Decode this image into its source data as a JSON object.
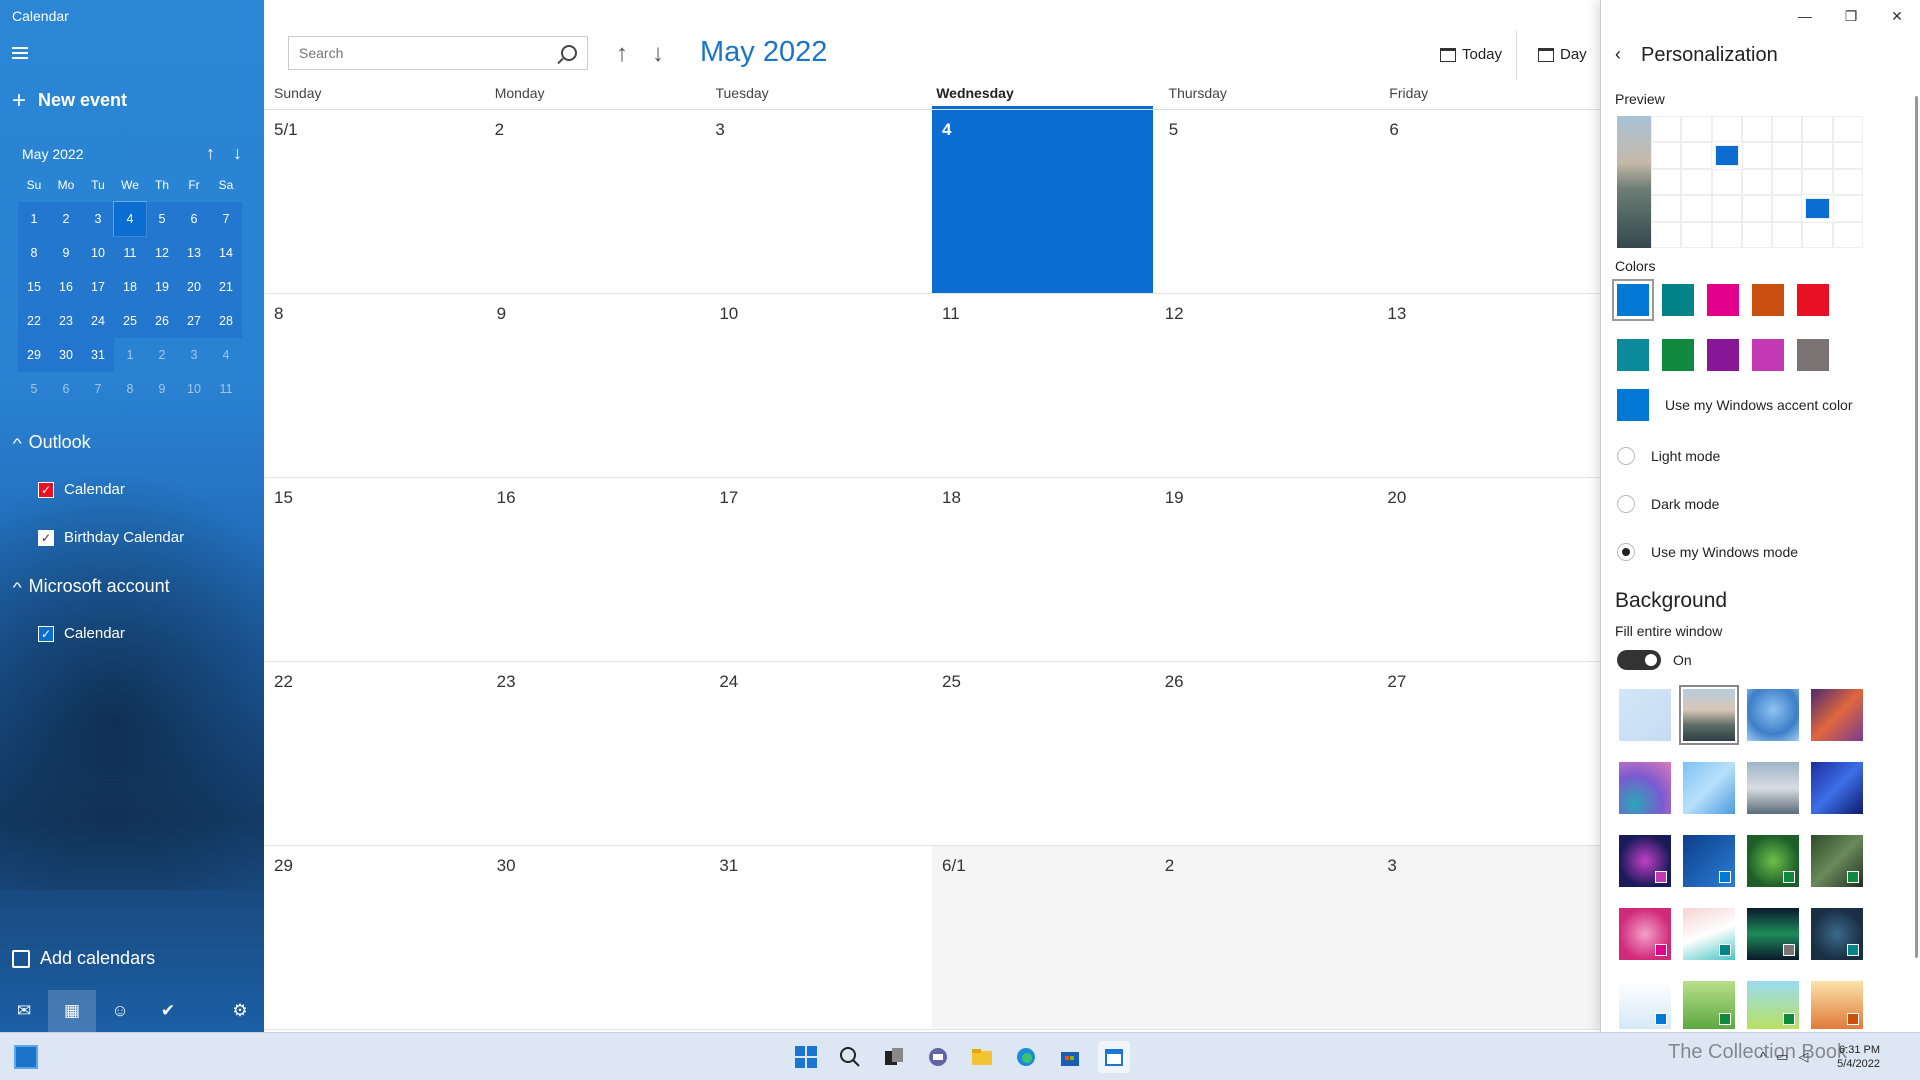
{
  "app": {
    "title": "Calendar"
  },
  "sidebar": {
    "new_event": "New event",
    "mini_month": "May 2022",
    "dow": [
      "Su",
      "Mo",
      "Tu",
      "We",
      "Th",
      "Fr",
      "Sa"
    ],
    "weeks": [
      [
        "1",
        "2",
        "3",
        "4",
        "5",
        "6",
        "7"
      ],
      [
        "8",
        "9",
        "10",
        "11",
        "12",
        "13",
        "14"
      ],
      [
        "15",
        "16",
        "17",
        "18",
        "19",
        "20",
        "21"
      ],
      [
        "22",
        "23",
        "24",
        "25",
        "26",
        "27",
        "28"
      ],
      [
        "29",
        "30",
        "31",
        "1",
        "2",
        "3",
        "4"
      ],
      [
        "5",
        "6",
        "7",
        "8",
        "9",
        "10",
        "11"
      ]
    ],
    "accounts": [
      {
        "name": "Outlook",
        "calendars": [
          "Calendar",
          "Birthday Calendar"
        ]
      },
      {
        "name": "Microsoft account",
        "calendars": [
          "Calendar"
        ]
      }
    ],
    "add_calendars": "Add calendars"
  },
  "main": {
    "search_placeholder": "Search",
    "month_title": "May 2022",
    "today_label": "Today",
    "day_label": "Day",
    "weekdays": [
      "Sunday",
      "Monday",
      "Tuesday",
      "Wednesday",
      "Thursday",
      "Friday"
    ],
    "weeks": [
      [
        "5/1",
        "2",
        "3",
        "4",
        "5",
        "6"
      ],
      [
        "8",
        "9",
        "10",
        "11",
        "12",
        "13"
      ],
      [
        "15",
        "16",
        "17",
        "18",
        "19",
        "20"
      ],
      [
        "22",
        "23",
        "24",
        "25",
        "26",
        "27"
      ],
      [
        "29",
        "30",
        "31",
        "6/1",
        "2",
        "3"
      ]
    ]
  },
  "panel": {
    "back_icon": "chevron-left-icon",
    "title": "Personalization",
    "preview_label": "Preview",
    "colors_label": "Colors",
    "colors_row1": [
      "#0078d4",
      "#038387",
      "#e3008c",
      "#ca5010",
      "#e81123"
    ],
    "colors_row2": [
      "#0a8a9a",
      "#10893e",
      "#881798",
      "#c239b3",
      "#7a7574"
    ],
    "accent_label": "Use my Windows accent color",
    "modes": [
      "Light mode",
      "Dark mode",
      "Use my Windows mode"
    ],
    "background_title": "Background",
    "fill_label": "Fill entire window",
    "toggle_state": "On",
    "selected_background": 1
  },
  "taskbar": {
    "time": "6:31 PM",
    "date": "5/4/2022",
    "watermark": "The Collection Book"
  }
}
